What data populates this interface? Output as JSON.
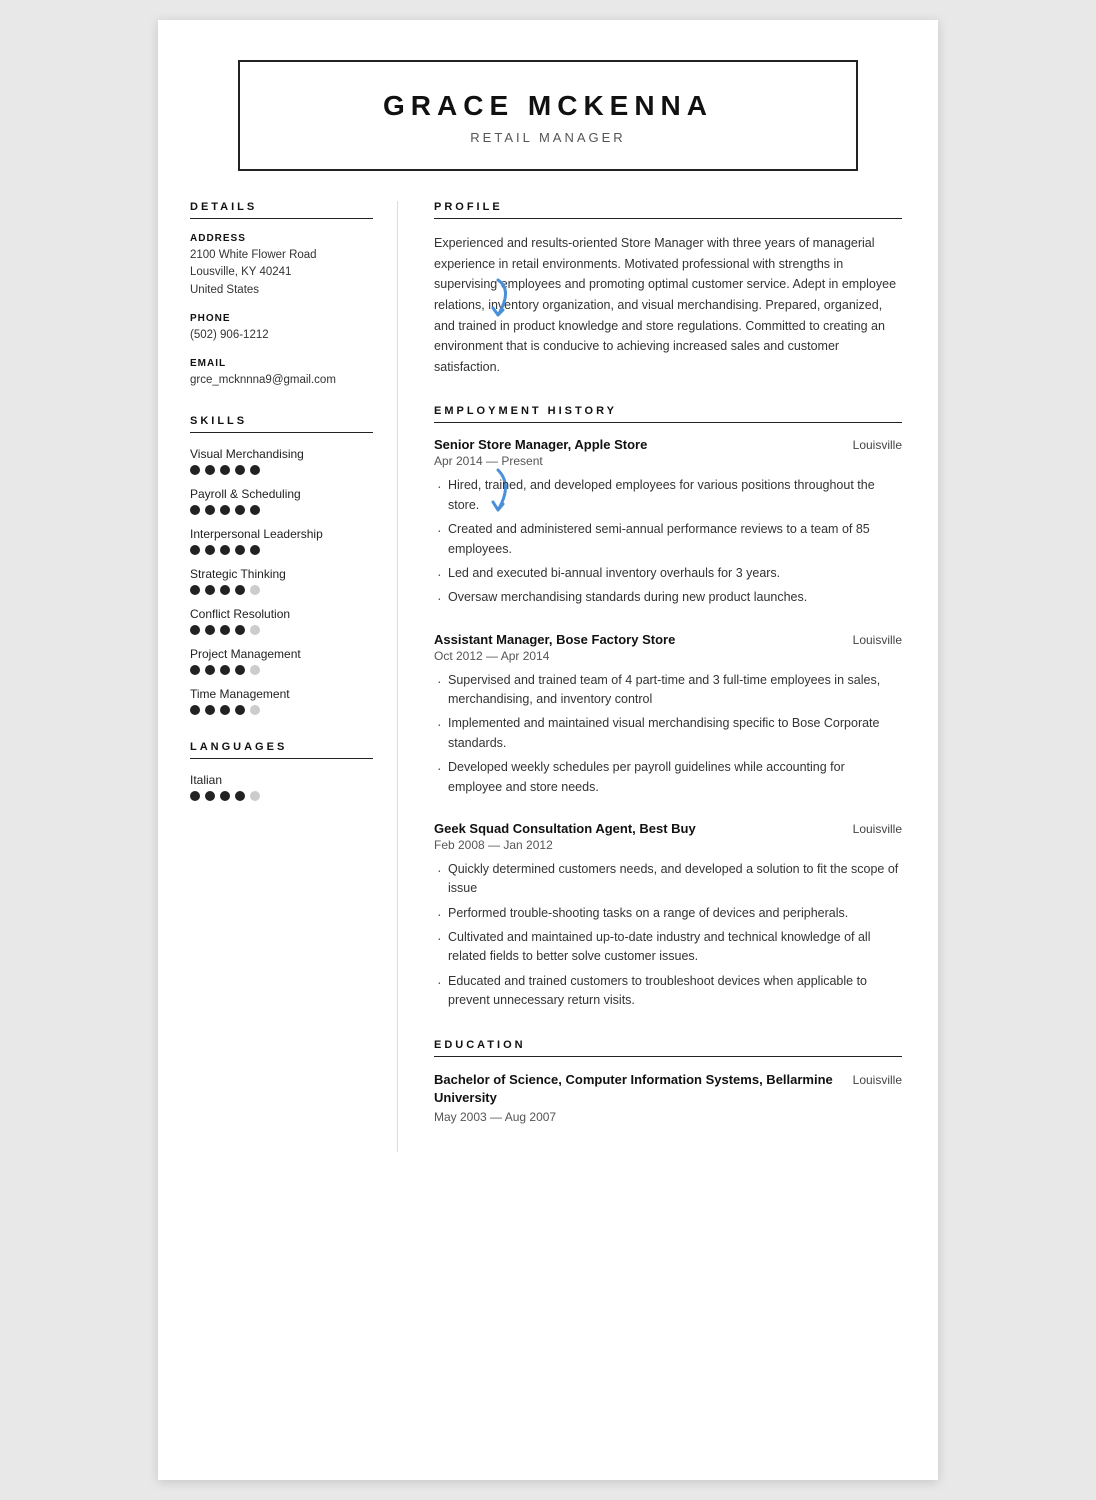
{
  "header": {
    "name": "GRACE MCKENNA",
    "title": "RETAIL MANAGER"
  },
  "details": {
    "section_label": "DETAILS",
    "address_label": "ADDRESS",
    "address_line1": "2100 White Flower Road",
    "address_line2": "Lousville, KY 40241",
    "address_line3": "United States",
    "phone_label": "PHONE",
    "phone": "(502) 906-1212",
    "email_label": "EMAIL",
    "email": "grce_mcknnna9@gmail.com"
  },
  "skills": {
    "section_label": "SKILLS",
    "items": [
      {
        "name": "Visual Merchandising",
        "filled": 5,
        "empty": 0
      },
      {
        "name": "Payroll & Scheduling",
        "filled": 5,
        "empty": 0
      },
      {
        "name": "Interpersonal Leadership",
        "filled": 5,
        "empty": 0
      },
      {
        "name": "Strategic Thinking",
        "filled": 4,
        "empty": 1
      },
      {
        "name": "Conflict Resolution",
        "filled": 4,
        "empty": 1
      },
      {
        "name": "Project Management",
        "filled": 4,
        "empty": 1
      },
      {
        "name": "Time Management",
        "filled": 4,
        "empty": 1
      }
    ]
  },
  "languages": {
    "section_label": "LANGUAGES",
    "items": [
      {
        "name": "Italian",
        "filled": 4,
        "empty": 1
      }
    ]
  },
  "profile": {
    "section_label": "PROFILE",
    "text": "Experienced and results-oriented Store Manager with three years of managerial experience in retail environments. Motivated professional with strengths in supervising employees and promoting optimal customer service. Adept in employee relations, inventory organization, and visual merchandising. Prepared, organized, and trained in product knowledge and store regulations. Committed to creating an environment that is conducive to achieving increased sales and customer satisfaction."
  },
  "employment": {
    "section_label": "EMPLOYMENT HISTORY",
    "jobs": [
      {
        "title": "Senior Store Manager, Apple Store",
        "location": "Louisville",
        "dates": "Apr 2014 — Present",
        "bullets": [
          "Hired, trained, and developed employees for various positions throughout the store.",
          "Created and administered semi-annual performance reviews to a team of 85 employees.",
          "Led and executed bi-annual inventory overhauls for 3 years.",
          "Oversaw merchandising standards during new product launches."
        ]
      },
      {
        "title": "Assistant Manager, Bose Factory Store",
        "location": "Louisville",
        "dates": "Oct 2012 — Apr 2014",
        "bullets": [
          "Supervised and trained team of 4 part-time and 3 full-time employees in sales, merchandising, and inventory control",
          "Implemented and maintained visual merchandising specific to Bose Corporate standards.",
          "Developed weekly schedules per payroll guidelines while accounting for employee and store needs."
        ]
      },
      {
        "title": "Geek Squad Consultation Agent, Best Buy",
        "location": "Louisville",
        "dates": "Feb 2008 — Jan 2012",
        "bullets": [
          "Quickly determined customers needs, and developed a solution to fit the scope of issue",
          "Performed trouble-shooting tasks on a range of devices and peripherals.",
          "Cultivated and maintained up-to-date industry and technical knowledge of all related fields to better solve customer issues.",
          "Educated and trained customers to troubleshoot devices when applicable to prevent unnecessary return visits."
        ]
      }
    ]
  },
  "education": {
    "section_label": "EDUCATION",
    "entries": [
      {
        "degree": "Bachelor of Science, Computer Information Systems, Bellarmine University",
        "location": "Louisville",
        "dates": "May 2003 — Aug 2007"
      }
    ]
  }
}
